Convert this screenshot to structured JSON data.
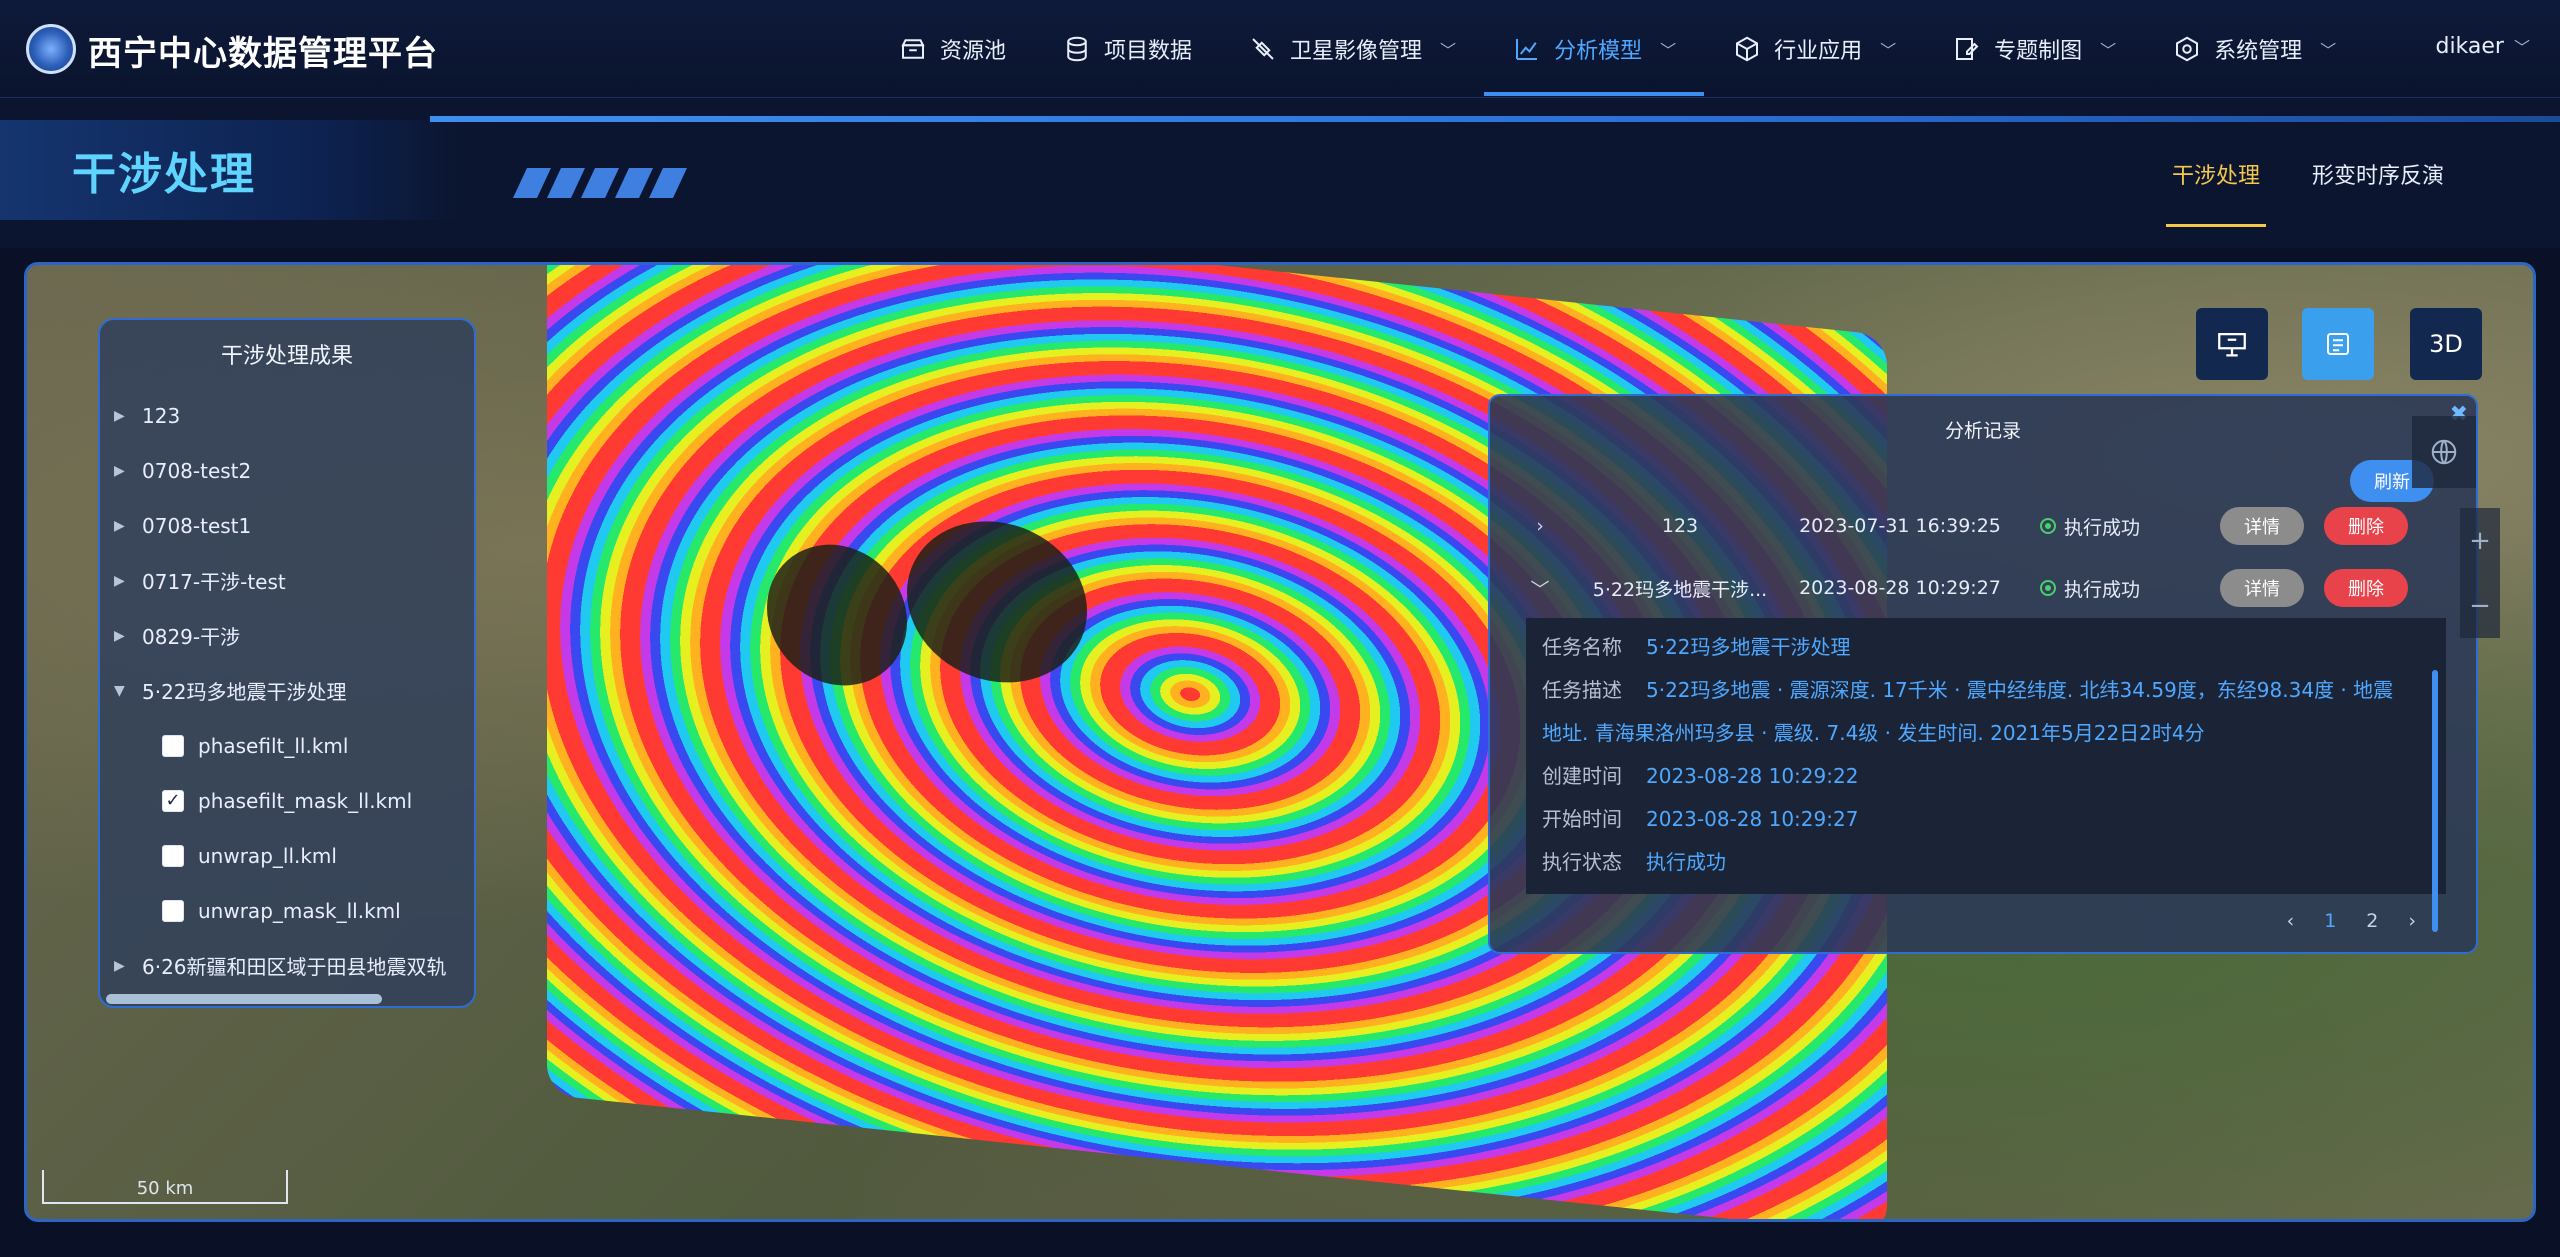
{
  "app": {
    "brand": "西宁中心数据管理平台",
    "user": "dikaer"
  },
  "nav": [
    {
      "label": "资源池",
      "icon": "resource-pool-icon",
      "dropdown": false,
      "active": false
    },
    {
      "label": "项目数据",
      "icon": "database-icon",
      "dropdown": false,
      "active": false
    },
    {
      "label": "卫星影像管理",
      "icon": "satellite-icon",
      "dropdown": true,
      "active": false
    },
    {
      "label": "分析模型",
      "icon": "chart-icon",
      "dropdown": true,
      "active": true
    },
    {
      "label": "行业应用",
      "icon": "cube-icon",
      "dropdown": true,
      "active": false
    },
    {
      "label": "专题制图",
      "icon": "map-edit-icon",
      "dropdown": true,
      "active": false
    },
    {
      "label": "系统管理",
      "icon": "settings-icon",
      "dropdown": true,
      "active": false
    }
  ],
  "page": {
    "title": "干涉处理",
    "tabs": [
      {
        "label": "干涉处理",
        "active": true
      },
      {
        "label": "形变时序反演",
        "active": false
      }
    ]
  },
  "left_panel": {
    "title": "干涉处理成果",
    "items": [
      "123",
      "0708-test2",
      "0708-test1",
      "0717-干涉-test",
      "0829-干涉",
      "5·22玛多地震干涉处理",
      "6·26新疆和田区域于田县地震双轨"
    ],
    "children": [
      {
        "label": "phasefilt_ll.kml",
        "checked": false
      },
      {
        "label": "phasefilt_mask_ll.kml",
        "checked": true
      },
      {
        "label": "unwrap_ll.kml",
        "checked": false
      },
      {
        "label": "unwrap_mask_ll.kml",
        "checked": false
      }
    ]
  },
  "map_tools": {
    "btn3d": "3D"
  },
  "records": {
    "title": "分析记录",
    "refresh": "刷新",
    "rows": [
      {
        "name": "123",
        "time": "2023-07-31 16:39:25",
        "status": "执行成功",
        "detail": "详情",
        "delete": "删除"
      },
      {
        "name": "5·22玛多地震干涉...",
        "time": "2023-08-28 10:29:27",
        "status": "执行成功",
        "detail": "详情",
        "delete": "删除"
      }
    ],
    "detail": {
      "task_name_label": "任务名称",
      "task_name": "5·22玛多地震干涉处理",
      "desc_label": "任务描述",
      "desc_line1": "5·22玛多地震 · 震源深度. 17千米 · 震中经纬度. 北纬34.59度，东经98.34度 · 地震",
      "desc_line2": "地址. 青海果洛州玛多县 · 震级. 7.4级 · 发生时间. 2021年5月22日2时4分",
      "created_label": "创建时间",
      "created": "2023-08-28 10:29:22",
      "start_label": "开始时间",
      "start": "2023-08-28 10:29:27",
      "state_label": "执行状态",
      "state": "执行成功"
    },
    "pager": {
      "prev": "‹",
      "page1": "1",
      "page2": "2",
      "next": "›"
    }
  },
  "scale": "50 km"
}
